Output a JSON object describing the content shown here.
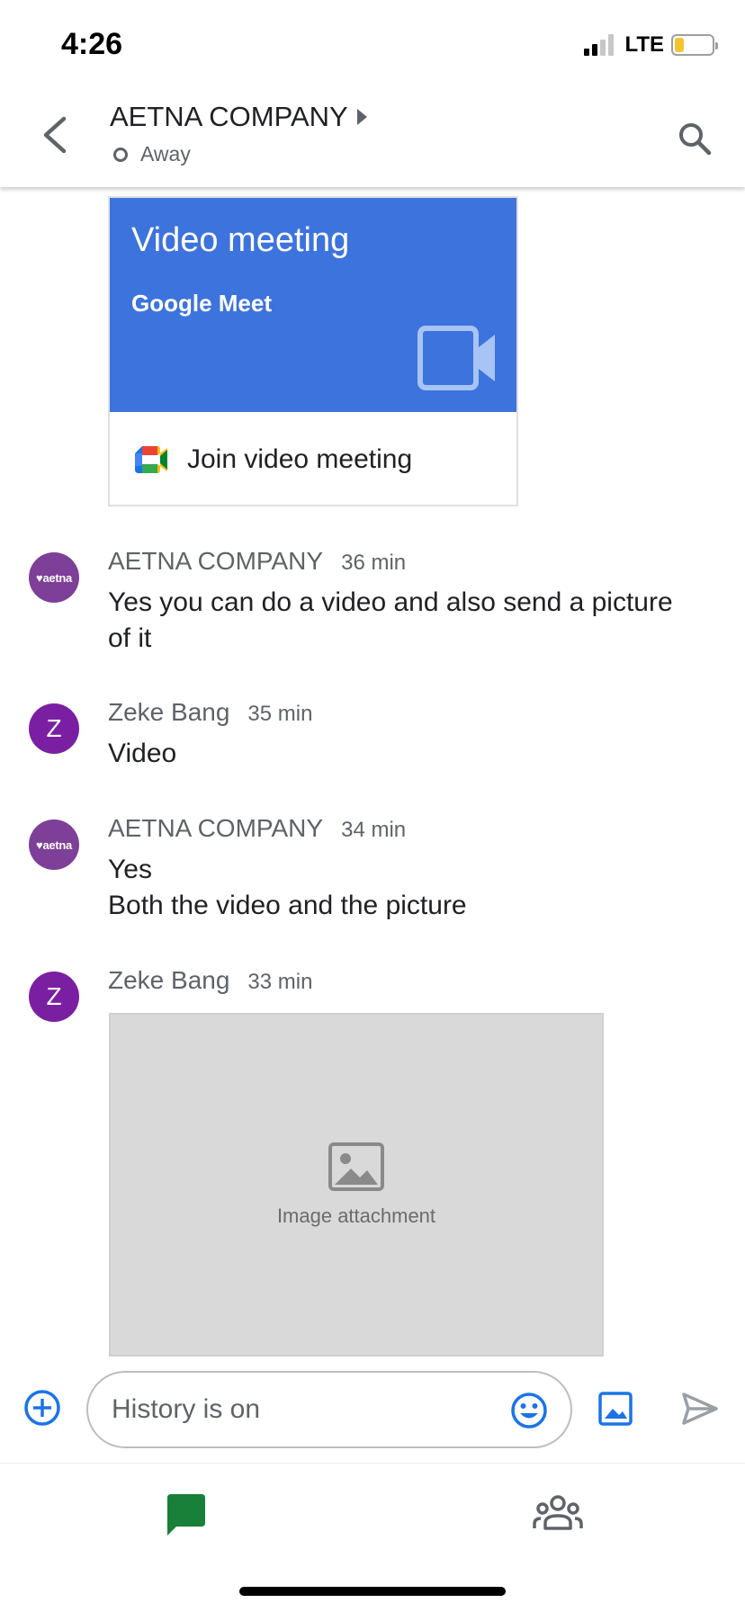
{
  "status_bar": {
    "time": "4:26",
    "network": "LTE",
    "signal_bars_on": 2,
    "signal_bars_total": 4,
    "battery_fraction": 0.25,
    "battery_color": "#f4c430"
  },
  "header": {
    "title": "AETNA COMPANY",
    "presence": "Away",
    "back_icon": "chevron-left-icon",
    "search_icon": "search-icon"
  },
  "meet_card": {
    "title": "Video meeting",
    "subtitle": "Google Meet",
    "join_label": "Join video meeting",
    "accent_color": "#3d73dd"
  },
  "messages": [
    {
      "sender": "AETNA COMPANY",
      "time": "36 min",
      "avatar": "aetna",
      "avatar_text": "♥aetna",
      "lines": [
        "Yes you can do a video and also send a picture of it"
      ]
    },
    {
      "sender": "Zeke Bang",
      "time": "35 min",
      "avatar": "zeke",
      "avatar_text": "Z",
      "lines": [
        "Video"
      ]
    },
    {
      "sender": "AETNA COMPANY",
      "time": "34 min",
      "avatar": "aetna",
      "avatar_text": "♥aetna",
      "lines": [
        "Yes",
        "Both the video and the picture"
      ]
    },
    {
      "sender": "Zeke Bang",
      "time": "33 min",
      "avatar": "zeke",
      "avatar_text": "Z",
      "lines": []
    }
  ],
  "attachment": {
    "placeholder_label": "Image attachment"
  },
  "composer": {
    "placeholder": "History is on",
    "accent_color": "#1a73e8"
  },
  "bottom_nav": {
    "chat_icon": "chat-icon",
    "people_icon": "people-icon",
    "active_color": "#188038"
  }
}
